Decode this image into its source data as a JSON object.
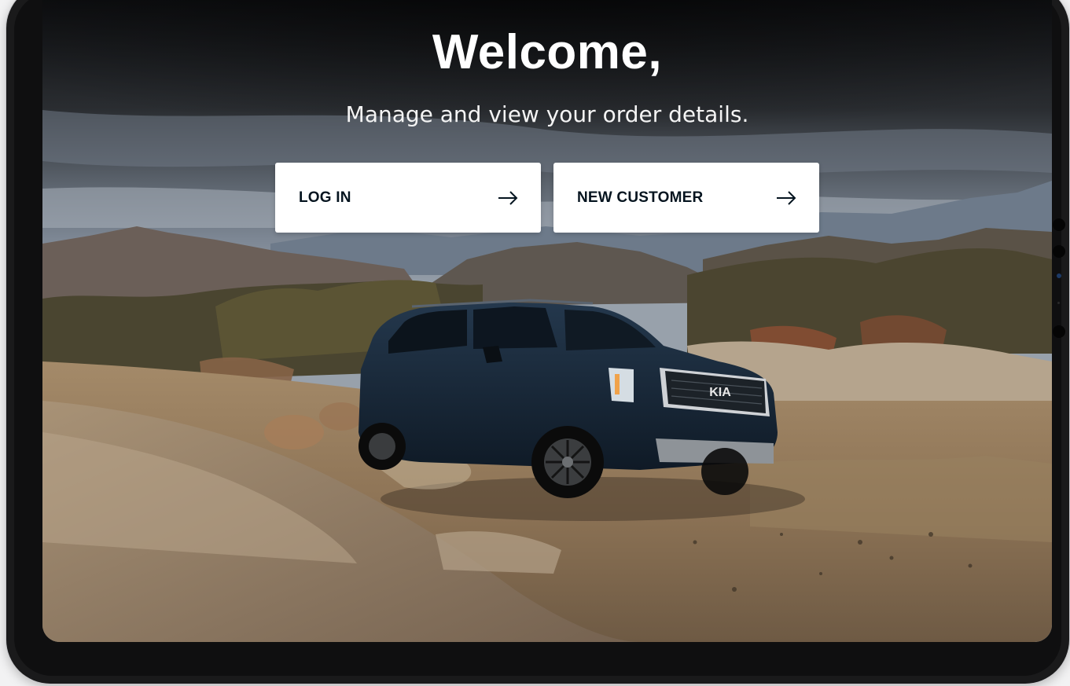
{
  "hero": {
    "title": "Welcome,",
    "subtitle": "Manage and view your order details."
  },
  "actions": {
    "login_label": "LOG IN",
    "login_icon": "arrow-right-icon",
    "new_customer_label": "NEW CUSTOMER",
    "new_customer_icon": "arrow-right-icon"
  },
  "background": {
    "brand_badge": "KIA"
  },
  "colors": {
    "button_bg": "#ffffff",
    "button_text": "#05141f",
    "headline_text": "#ffffff"
  }
}
